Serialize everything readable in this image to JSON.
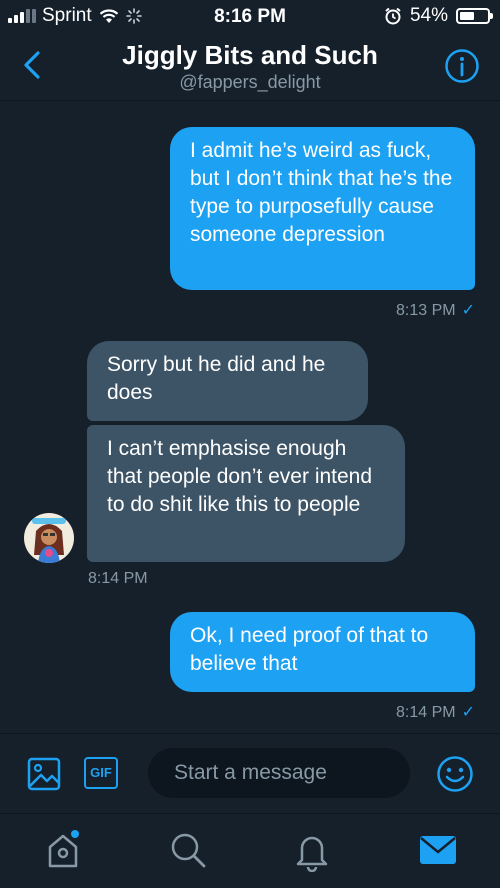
{
  "status_bar": {
    "carrier": "Sprint",
    "time": "8:16 PM",
    "battery_percent": "54%",
    "battery_level": 0.54
  },
  "header": {
    "title": "Jiggly Bits and Such",
    "handle": "@fappers_delight"
  },
  "messages": [
    {
      "direction": "outgoing",
      "text": "I admit he’s weird as fuck, but I don’t think that he’s the type to purposefully cause someone depression",
      "time": "8:13 PM"
    },
    {
      "direction": "incoming",
      "text": "Sorry but he did and he does"
    },
    {
      "direction": "incoming",
      "text": "I can’t emphasise enough that people don’t ever intend to do shit like this to people",
      "time": "8:14 PM"
    },
    {
      "direction": "outgoing",
      "text": "Ok, I need proof of that to believe that",
      "time": "8:14 PM"
    }
  ],
  "read_mark": "✓",
  "composer": {
    "placeholder": "Start a message",
    "gif_label": "GIF"
  },
  "colors": {
    "background": "#15202b",
    "accent": "#1da1f2",
    "incoming_bubble": "#3d5466",
    "muted_text": "#8899a6"
  }
}
